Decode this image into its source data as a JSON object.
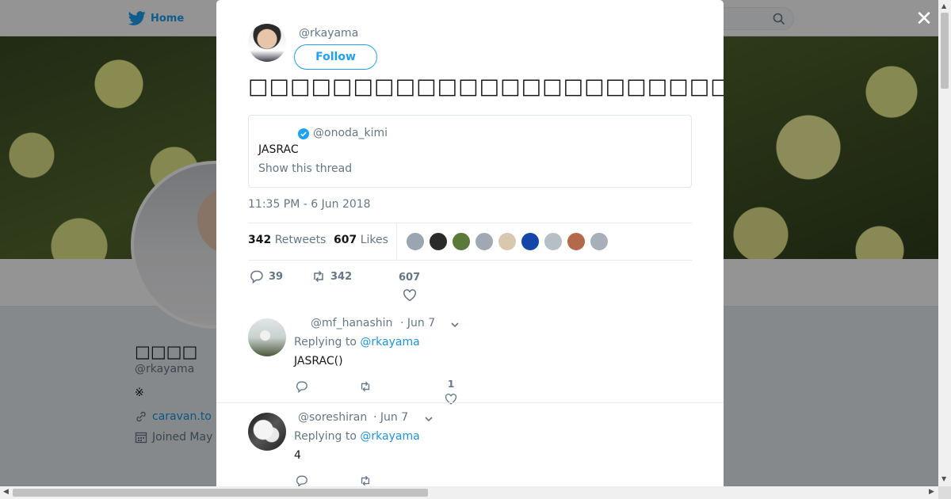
{
  "nav": {
    "home_label": "Home"
  },
  "profile": {
    "name": "□□□□",
    "handle": "@rkayama",
    "bio": "※",
    "link": "caravan.to",
    "joined": "Joined May"
  },
  "tweet": {
    "author_handle": "@rkayama",
    "follow_label": "Follow",
    "text": "□□□□□□□□□□□□□□□□□□□□□□□□□□□□□□□□□□□□□□□□□□□□□□□□□",
    "quote": {
      "handle": "@onoda_kimi",
      "text": "JASRAC",
      "show_thread": "Show this thread"
    },
    "timestamp": "11:35 PM - 6 Jun 2018",
    "stats": {
      "retweets_count": "342",
      "retweets_label": "Retweets",
      "likes_count": "607",
      "likes_label": "Likes"
    },
    "likers": [
      {
        "color": "#9aa5b1"
      },
      {
        "color": "#2a2a2a"
      },
      {
        "color": "#5b7a3a"
      },
      {
        "color": "#a0a9b3"
      },
      {
        "color": "#d8c8b0"
      },
      {
        "color": "#1346a8"
      },
      {
        "color": "#b6bfc6"
      },
      {
        "color": "#b46a4a"
      },
      {
        "color": "#a7b0b8"
      }
    ],
    "actions": {
      "replies": "39",
      "retweets": "342",
      "likes": "607"
    }
  },
  "replies": [
    {
      "handle": "@mf_hanashin",
      "date": "· Jun 7",
      "replying_prefix": "Replying to",
      "replying_to": "@rkayama",
      "text": "JASRAC()",
      "likes": "1"
    },
    {
      "handle": "@soreshiran",
      "date": "· Jun 7",
      "replying_prefix": "Replying to",
      "replying_to": "@rkayama",
      "text": "4",
      "likes": ""
    }
  ],
  "colors": {
    "accent": "#1da1f2",
    "link": "#1b95e0",
    "muted": "#657786"
  }
}
